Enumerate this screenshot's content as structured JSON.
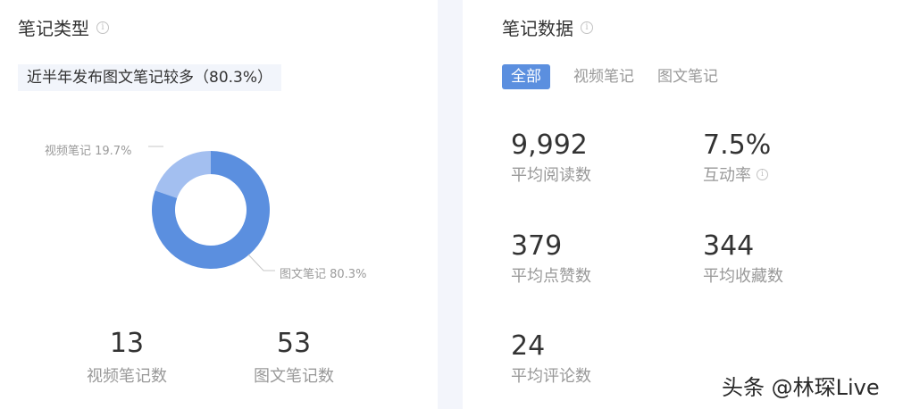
{
  "note_type": {
    "title": "笔记类型",
    "summary": "近半年发布图文笔记较多（80.3%）",
    "donut": {
      "slices": [
        {
          "label": "视频笔记 19.7%",
          "fraction": 0.197,
          "color": "#a3bff0"
        },
        {
          "label": "图文笔记 80.3%",
          "fraction": 0.803,
          "color": "#5b8fdf"
        }
      ]
    },
    "counts": [
      {
        "value": "13",
        "label": "视频笔记数"
      },
      {
        "value": "53",
        "label": "图文笔记数"
      }
    ]
  },
  "note_data": {
    "title": "笔记数据",
    "tabs": [
      {
        "label": "全部",
        "active": true
      },
      {
        "label": "视频笔记",
        "active": false
      },
      {
        "label": "图文笔记",
        "active": false
      }
    ],
    "metrics": [
      {
        "value": "9,992",
        "label": "平均阅读数"
      },
      {
        "value": "7.5%",
        "label": "互动率"
      },
      {
        "value": "379",
        "label": "平均点赞数"
      },
      {
        "value": "344",
        "label": "平均收藏数"
      },
      {
        "value": "24",
        "label": "平均评论数"
      }
    ]
  },
  "info_icon_glyph": "i",
  "watermark": "头条 @林琛Live",
  "colors": {
    "accent": "#5b8fdf",
    "accent_light": "#a3bff0"
  }
}
